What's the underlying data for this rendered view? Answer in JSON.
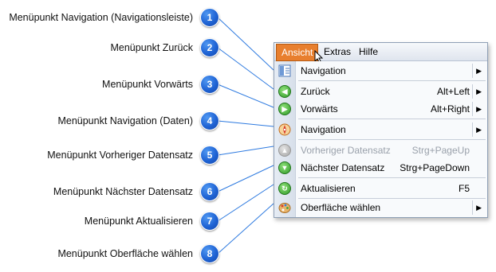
{
  "callouts": [
    {
      "number": "1",
      "label": "Menüpunkt Navigation (Navigationsleiste)"
    },
    {
      "number": "2",
      "label": "Menüpunkt Zurück"
    },
    {
      "number": "3",
      "label": "Menüpunkt Vorwärts"
    },
    {
      "number": "4",
      "label": "Menüpunkt Navigation (Daten)"
    },
    {
      "number": "5",
      "label": "Menüpunkt Vorheriger Datensatz"
    },
    {
      "number": "6",
      "label": "Menüpunkt Nächster Datensatz"
    },
    {
      "number": "7",
      "label": "Menüpunkt Aktualisieren"
    },
    {
      "number": "8",
      "label": "Menüpunkt Oberfläche wählen"
    }
  ],
  "menubar": {
    "items": [
      "Ansicht",
      "Extras",
      "Hilfe"
    ],
    "active": "Ansicht"
  },
  "menu": {
    "items": [
      {
        "label": "Navigation",
        "shortcut": "",
        "submenu": true,
        "icon": "navigation-bar-icon",
        "enabled": true
      },
      {
        "label": "Zurück",
        "shortcut": "Alt+Left",
        "submenu": true,
        "icon": "back-arrow-icon",
        "enabled": true
      },
      {
        "label": "Vorwärts",
        "shortcut": "Alt+Right",
        "submenu": true,
        "icon": "forward-arrow-icon",
        "enabled": true
      },
      {
        "label": "Navigation",
        "shortcut": "",
        "submenu": true,
        "icon": "compass-icon",
        "enabled": true
      },
      {
        "label": "Vorheriger Datensatz",
        "shortcut": "Strg+PageUp",
        "submenu": false,
        "icon": "up-arrow-icon",
        "enabled": false
      },
      {
        "label": "Nächster Datensatz",
        "shortcut": "Strg+PageDown",
        "submenu": false,
        "icon": "down-arrow-icon",
        "enabled": true
      },
      {
        "label": "Aktualisieren",
        "shortcut": "F5",
        "submenu": false,
        "icon": "refresh-icon",
        "enabled": true
      },
      {
        "label": "Oberfläche wählen",
        "shortcut": "",
        "submenu": true,
        "icon": "palette-icon",
        "enabled": true
      }
    ]
  },
  "colors": {
    "badge": "#1f63d4",
    "connector": "#2f7be0",
    "active_menu": "#e87f2e",
    "disabled_text": "#9aa1ab"
  }
}
